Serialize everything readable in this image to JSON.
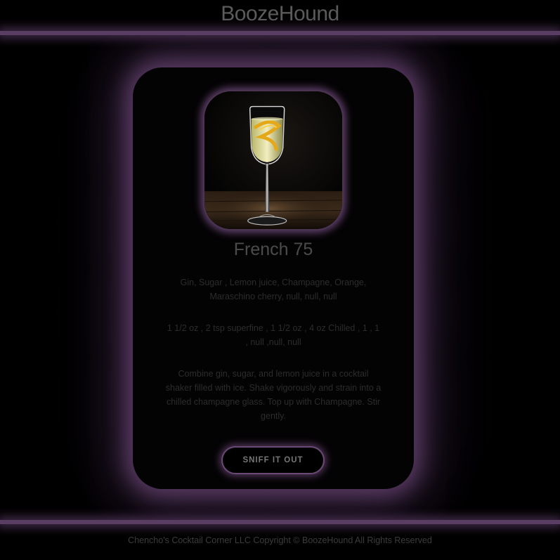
{
  "header": {
    "brand": "BoozeHound"
  },
  "card": {
    "image_icon": "cocktail-photo",
    "drink_name": "French 75",
    "ingredients": "Gin, Sugar , Lemon juice, Champagne, Orange, Maraschino cherry, null, null, null",
    "measures": "1 1/2 oz , 2 tsp superfine , 1 1/2 oz , 4 oz Chilled , 1 , 1 , null ,null, null",
    "instructions": "Combine gin, sugar, and lemon juice in a cocktail shaker filled with ice. Shake vigorously and strain into a chilled champagne glass. Top up with Champagne. Stir gently.",
    "button_label": "SNIFF IT OUT"
  },
  "footer": {
    "copyright": "Chencho's Cocktail Corner LLC Copyright © BoozeHound All Rights Reserved"
  },
  "colors": {
    "accent_glow": "#5a3d63",
    "background": "#000000",
    "card": "#040304"
  }
}
